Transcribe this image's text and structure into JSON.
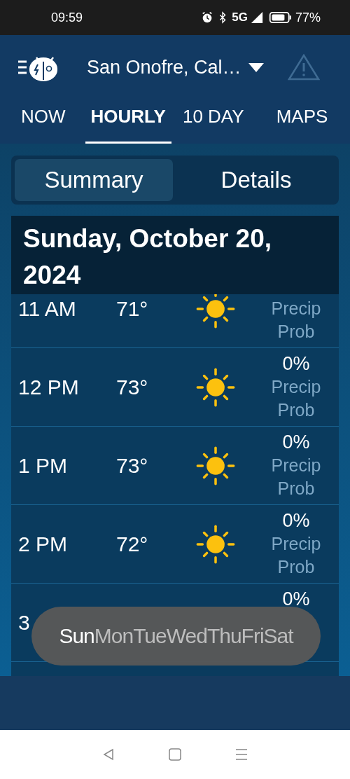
{
  "status_bar": {
    "time": "09:59",
    "network": "5G",
    "battery": "77%"
  },
  "header": {
    "location": "San Onofre, Cal…"
  },
  "tabs": [
    {
      "label": "NOW",
      "selected": false
    },
    {
      "label": "HOURLY",
      "selected": true
    },
    {
      "label": "10 DAY",
      "selected": false
    },
    {
      "label": "MAPS",
      "selected": false
    }
  ],
  "segments": [
    {
      "label": "Summary",
      "selected": true
    },
    {
      "label": "Details",
      "selected": false
    }
  ],
  "date_heading": "Sunday, October 20, 2024",
  "hours": [
    {
      "time": "11 AM",
      "temp": "71°",
      "precip_label": "Precip Prob",
      "clipped": true
    },
    {
      "time": "12 PM",
      "temp": "73°",
      "precip": "0%",
      "precip_label": "Precip Prob"
    },
    {
      "time": "1 PM",
      "temp": "73°",
      "precip": "0%",
      "precip_label": "Precip Prob"
    },
    {
      "time": "2 PM",
      "temp": "72°",
      "precip": "0%",
      "precip_label": "Precip Prob"
    },
    {
      "time": "3",
      "precip": "0%"
    }
  ],
  "day_picker": [
    {
      "label": "Sun",
      "selected": true
    },
    {
      "label": "Mon",
      "selected": false
    },
    {
      "label": "Tue",
      "selected": false
    },
    {
      "label": "Wed",
      "selected": false
    },
    {
      "label": "Thu",
      "selected": false
    },
    {
      "label": "Fri",
      "selected": false
    },
    {
      "label": "Sat",
      "selected": false
    }
  ]
}
